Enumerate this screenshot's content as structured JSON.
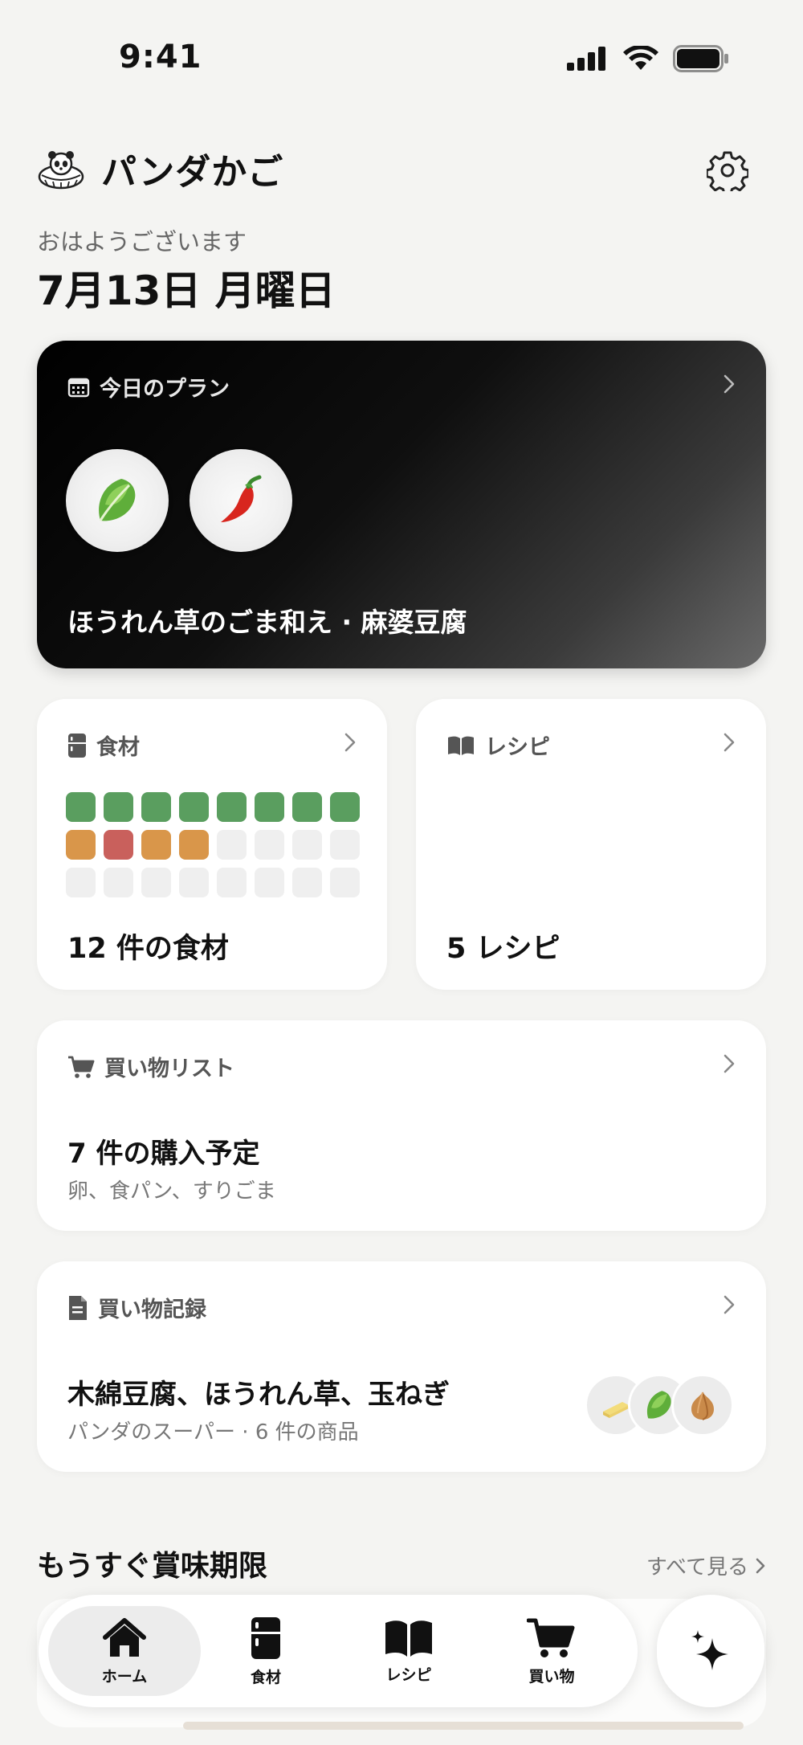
{
  "status_bar": {
    "time": "9:41"
  },
  "app": {
    "title": "パンダかご"
  },
  "greeting": "おはようございます",
  "date_title": "7月13日 月曜日",
  "plan": {
    "heading": "今日のプラン",
    "dishes": [
      "spinach-icon",
      "chili-pepper-icon"
    ],
    "menu": "ほうれん草のごま和え · 麻婆豆腐"
  },
  "ingredients": {
    "heading": "食材",
    "count_label": "12 件の食材",
    "grid": [
      "green",
      "green",
      "green",
      "green",
      "green",
      "green",
      "green",
      "green",
      "orange",
      "red",
      "orange",
      "orange",
      "empty",
      "empty",
      "empty",
      "empty",
      "empty",
      "empty",
      "empty",
      "empty",
      "empty",
      "empty",
      "empty",
      "empty"
    ],
    "colors": {
      "green": "#5a9e5f",
      "orange": "#d9964a",
      "red": "#c9605c",
      "empty": "#efefef"
    }
  },
  "recipes": {
    "heading": "レシピ",
    "count_label": "5 レシピ"
  },
  "shopping_list": {
    "heading": "買い物リスト",
    "title": "7 件の購入予定",
    "items": "卵、食パン、すりごま"
  },
  "purchase_history": {
    "heading": "買い物記録",
    "title": "木綿豆腐、ほうれん草、玉ねぎ",
    "sub": "パンダのスーパー · 6 件の商品",
    "thumbs": [
      "butter-icon",
      "spinach-icon",
      "onion-icon"
    ]
  },
  "expiring": {
    "title": "もうすぐ賞味期限",
    "see_all": "すべて見る"
  },
  "tabs": [
    {
      "label": "ホーム",
      "icon": "home-icon",
      "active": true
    },
    {
      "label": "食材",
      "icon": "fridge-icon",
      "active": false
    },
    {
      "label": "レシピ",
      "icon": "book-icon",
      "active": false
    },
    {
      "label": "買い物",
      "icon": "cart-icon",
      "active": false
    }
  ],
  "ai_button": {
    "icon": "sparkle-icon"
  }
}
